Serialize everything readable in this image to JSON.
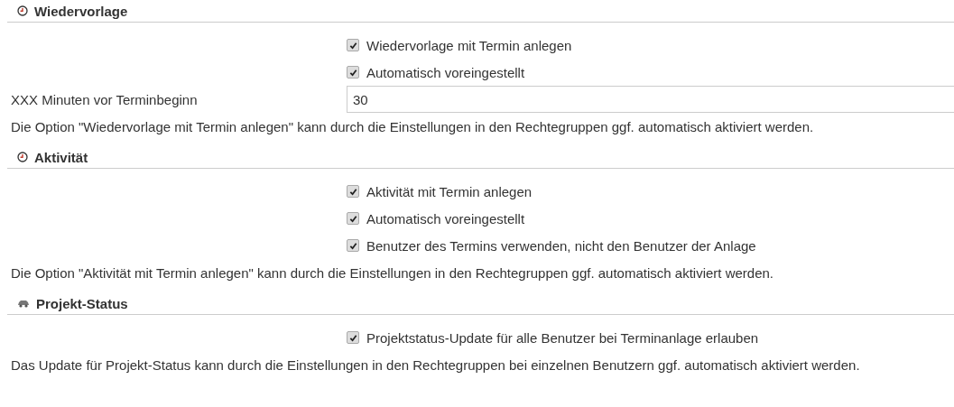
{
  "sections": [
    {
      "title": "Wiedervorlage",
      "kind": "timed",
      "items": [
        {
          "kind": "checkbox",
          "label": "Wiedervorlage mit Termin anlegen",
          "checked": true
        },
        {
          "kind": "checkbox",
          "label": "Automatisch voreingestellt",
          "checked": true
        },
        {
          "kind": "field",
          "label": "XXX Minuten vor Terminbeginn",
          "value": "30"
        }
      ],
      "note": "Die Option \"Wiedervorlage mit Termin anlegen\" kann durch die Einstellungen in den Rechtegruppen ggf. automatisch aktiviert werden."
    },
    {
      "title": "Aktivität",
      "kind": "timed",
      "items": [
        {
          "kind": "checkbox",
          "label": "Aktivität mit Termin anlegen",
          "checked": true
        },
        {
          "kind": "checkbox",
          "label": "Automatisch voreingestellt",
          "checked": true
        },
        {
          "kind": "checkbox",
          "label": "Benutzer des Termins verwenden, nicht den Benutzer der Anlage",
          "checked": true
        }
      ],
      "note": "Die Option \"Aktivität mit Termin anlegen\" kann durch die Einstellungen in den Rechtegruppen ggf. automatisch aktiviert werden."
    },
    {
      "title": "Projekt-Status",
      "kind": "status",
      "items": [
        {
          "kind": "checkbox",
          "label": "Projektstatus-Update für alle Benutzer bei Terminanlage erlauben",
          "checked": true
        }
      ],
      "note": "Das Update für Projekt-Status kann durch die Einstellungen in den Rechtegruppen bei einzelnen Benutzern ggf. automatisch aktiviert werden."
    }
  ]
}
